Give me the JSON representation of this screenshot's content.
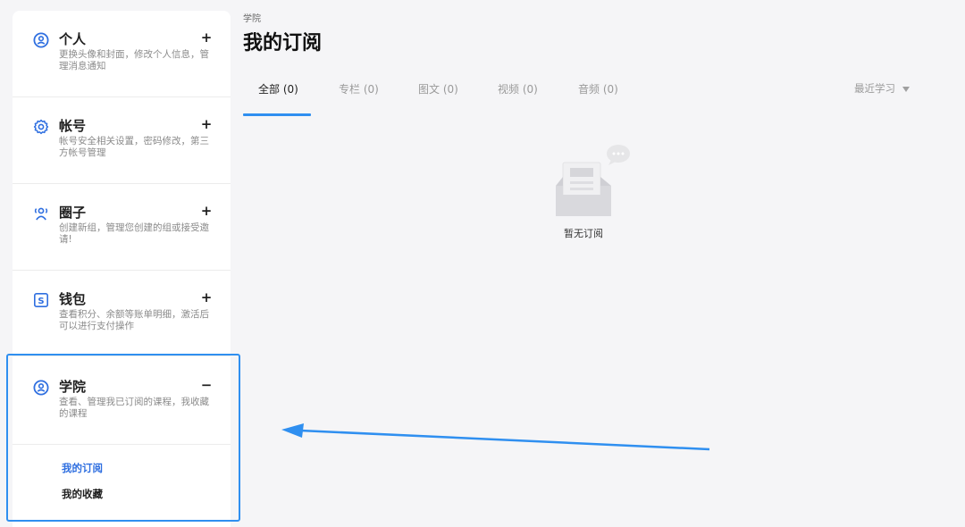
{
  "sidebar": {
    "sections": [
      {
        "title": "个人",
        "toggle": "+",
        "desc": "更换头像和封面，修改个人信息，管理消息通知",
        "icon": "user-circle-icon"
      },
      {
        "title": "帐号",
        "toggle": "+",
        "desc": "帐号安全相关设置，密码修改，第三方帐号管理",
        "icon": "gear-icon"
      },
      {
        "title": "圈子",
        "toggle": "+",
        "desc": "创建新组，管理您创建的组或接受邀请!",
        "icon": "group-icon"
      },
      {
        "title": "钱包",
        "toggle": "+",
        "desc": "查看积分、余额等账单明细，激活后可以进行支付操作",
        "icon": "wallet-icon"
      },
      {
        "title": "学院",
        "toggle": "−",
        "desc": "查看、管理我已订阅的课程，我收藏的课程",
        "icon": "user-circle-icon"
      }
    ],
    "sub_items": [
      {
        "label": "我的订阅",
        "active": true
      },
      {
        "label": "我的收藏",
        "active": false
      }
    ]
  },
  "header": {
    "breadcrumb": "学院",
    "title": "我的订阅"
  },
  "tabs": [
    {
      "label": "全部 (0)",
      "active": true
    },
    {
      "label": "专栏 (0)",
      "active": false
    },
    {
      "label": "图文 (0)",
      "active": false
    },
    {
      "label": "视频 (0)",
      "active": false
    },
    {
      "label": "音频 (0)",
      "active": false
    }
  ],
  "sort": {
    "label": "最近学习",
    "icon": "caret-down-icon"
  },
  "empty_state": {
    "text": "暂无订阅",
    "icon": "empty-inbox-icon"
  },
  "colors": {
    "accent": "#2f8ff0",
    "sidebar_bg": "#ffffff",
    "page_bg": "#f5f5f7"
  }
}
